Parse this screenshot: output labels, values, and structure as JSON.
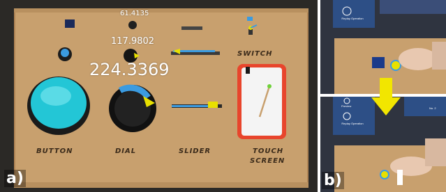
{
  "panel_a": {
    "letter": "a)",
    "readouts": {
      "top": "61.4135",
      "mid": "117.9802",
      "large": "224.3369"
    },
    "labels": {
      "button": "BUTTON",
      "dial": "DIAL",
      "slider": "SLIDER",
      "switch": "SWITCH",
      "touch_screen_line1": "TOUCH",
      "touch_screen_line2": "SCREEN"
    }
  },
  "panel_b": {
    "letter": "b)",
    "top_screen": {
      "label": "Replay Operation"
    },
    "bottom_screen": {
      "label1": "Preview",
      "label2": "Replay Operation",
      "label3": "No. 2"
    }
  },
  "colors": {
    "board": "#c8a06e",
    "accent_blue": "#3b9be0",
    "accent_yellow": "#e8e000",
    "accent_green": "#6fd23a",
    "touch_screen_border": "#e8452c"
  }
}
